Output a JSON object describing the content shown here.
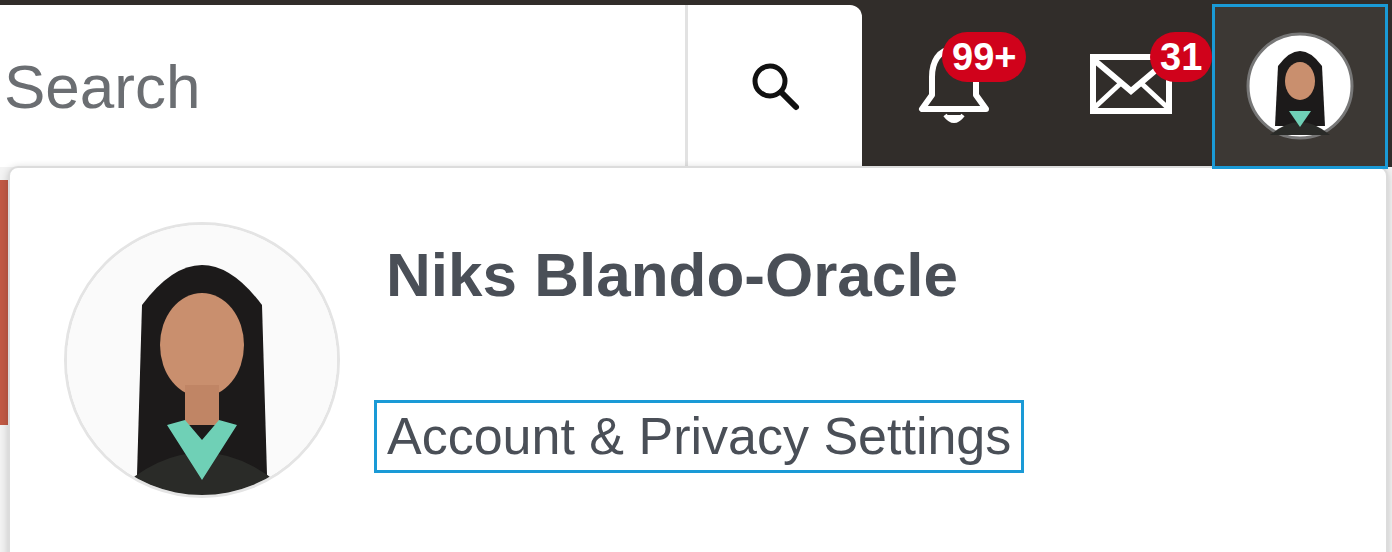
{
  "search": {
    "placeholder": "Search"
  },
  "notifications": {
    "badge": "99+"
  },
  "messages": {
    "badge": "31"
  },
  "profile_menu": {
    "expanded": true,
    "name": "Niks Blando-Oracle",
    "settings_link": {
      "label": "Account & Privacy Settings",
      "focused": true
    }
  }
}
